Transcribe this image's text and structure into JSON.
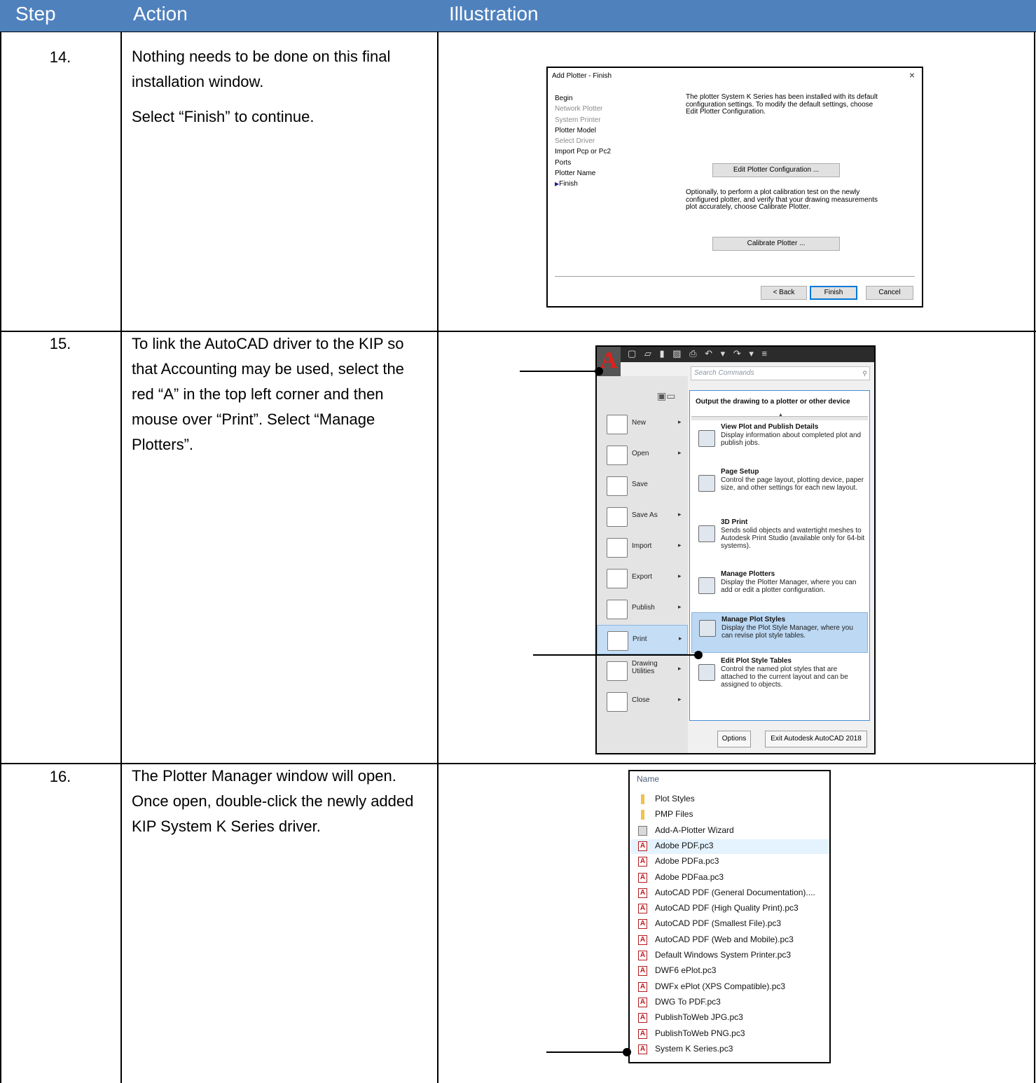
{
  "table": {
    "headers": {
      "step": "Step",
      "action": "Action",
      "illustration": "Illustration"
    },
    "rows": [
      {
        "step": "14.",
        "paragraphs": [
          "Nothing needs to be done on this final installation window.",
          "Select “Finish” to continue."
        ]
      },
      {
        "step": "15.",
        "paragraphs": [
          "To link the AutoCAD driver to the KIP so that Accounting may be used, select the red “A” in the top left corner and then mouse over “Print”. Select “Manage Plotters”."
        ]
      },
      {
        "step": "16.",
        "paragraphs": [
          "The Plotter Manager window will open. Once open, double-click the newly added KIP System K Series driver."
        ]
      }
    ]
  },
  "dialog": {
    "title": "Add Plotter - Finish",
    "close": "×",
    "steps": [
      {
        "label": "Begin",
        "state": "enabled"
      },
      {
        "label": "Network Plotter",
        "state": "disabled"
      },
      {
        "label": "System Printer",
        "state": "disabled"
      },
      {
        "label": "Plotter Model",
        "state": "enabled"
      },
      {
        "label": "Select Driver",
        "state": "disabled"
      },
      {
        "label": "Import Pcp or Pc2",
        "state": "enabled"
      },
      {
        "label": "Ports",
        "state": "enabled"
      },
      {
        "label": "Plotter Name",
        "state": "enabled"
      },
      {
        "label": "Finish",
        "state": "current"
      }
    ],
    "text1": [
      "The plotter System K Series has been installed with its default",
      "configuration settings.  To modify the default settings, choose",
      "Edit Plotter Configuration."
    ],
    "edit_button": "Edit Plotter Configuration ...",
    "text2": [
      "Optionally, to perform a plot calibration test on the newly",
      "configured plotter, and verify that your drawing measurements",
      "plot accurately, choose Calibrate Plotter."
    ],
    "calibrate_button": "Calibrate Plotter ...",
    "back_button": "< Back",
    "finish_button": "Finish",
    "cancel_button": "Cancel"
  },
  "acad": {
    "logo": "A",
    "search_placeholder": "Search Commands",
    "panel_heading": "Output the drawing to a plotter or other device",
    "menu": [
      {
        "label": "New",
        "arrow": true
      },
      {
        "label": "Open",
        "arrow": true
      },
      {
        "label": "Save",
        "arrow": false
      },
      {
        "label": "Save As",
        "arrow": true
      },
      {
        "label": "Import",
        "arrow": true
      },
      {
        "label": "Export",
        "arrow": true
      },
      {
        "label": "Publish",
        "arrow": true
      },
      {
        "label": "Print",
        "arrow": true,
        "selected": true
      },
      {
        "label": "Drawing\nUtilities",
        "arrow": true
      },
      {
        "label": "Close",
        "arrow": true
      }
    ],
    "items": [
      {
        "title": "View Plot and Publish Details",
        "desc": "Display information about completed plot and publish jobs."
      },
      {
        "title": "Page Setup",
        "desc": "Control the page layout, plotting device, paper size, and other settings for each new layout."
      },
      {
        "title": "3D Print",
        "desc": "Sends solid objects and watertight meshes to Autodesk Print Studio (available only for 64-bit systems)."
      },
      {
        "title": "Manage Plotters",
        "desc": "Display the Plotter Manager, where you can add or edit a plotter configuration."
      },
      {
        "title": "Manage Plot Styles",
        "desc": "Display the Plot Style Manager, where you can revise plot style tables.",
        "selected": true
      },
      {
        "title": "Edit Plot Style Tables",
        "desc": "Control the named plot styles that are attached to the current layout and can be assigned to objects."
      }
    ],
    "options_button": "Options",
    "exit_button": "Exit Autodesk AutoCAD 2018"
  },
  "files": {
    "column": "Name",
    "items": [
      {
        "name": "Plot Styles",
        "kind": "folder"
      },
      {
        "name": "PMP Files",
        "kind": "folder"
      },
      {
        "name": "Add-A-Plotter Wizard",
        "kind": "wizard"
      },
      {
        "name": "Adobe PDF.pc3",
        "kind": "pc3",
        "highlight": true
      },
      {
        "name": "Adobe PDFa.pc3",
        "kind": "pc3"
      },
      {
        "name": "Adobe PDFaa.pc3",
        "kind": "pc3"
      },
      {
        "name": "AutoCAD PDF (General Documentation)....",
        "kind": "pc3"
      },
      {
        "name": "AutoCAD PDF (High Quality Print).pc3",
        "kind": "pc3"
      },
      {
        "name": "AutoCAD PDF (Smallest File).pc3",
        "kind": "pc3"
      },
      {
        "name": "AutoCAD PDF (Web and Mobile).pc3",
        "kind": "pc3"
      },
      {
        "name": "Default Windows System Printer.pc3",
        "kind": "pc3"
      },
      {
        "name": "DWF6 ePlot.pc3",
        "kind": "pc3"
      },
      {
        "name": "DWFx ePlot (XPS Compatible).pc3",
        "kind": "pc3"
      },
      {
        "name": "DWG To PDF.pc3",
        "kind": "pc3"
      },
      {
        "name": "PublishToWeb JPG.pc3",
        "kind": "pc3"
      },
      {
        "name": "PublishToWeb PNG.pc3",
        "kind": "pc3"
      },
      {
        "name": "System K Series.pc3",
        "kind": "pc3"
      }
    ]
  },
  "colors": {
    "header_bg": "#4f81bd",
    "acad_red": "#e0201b",
    "selection_blue": "#bcd8f3"
  }
}
